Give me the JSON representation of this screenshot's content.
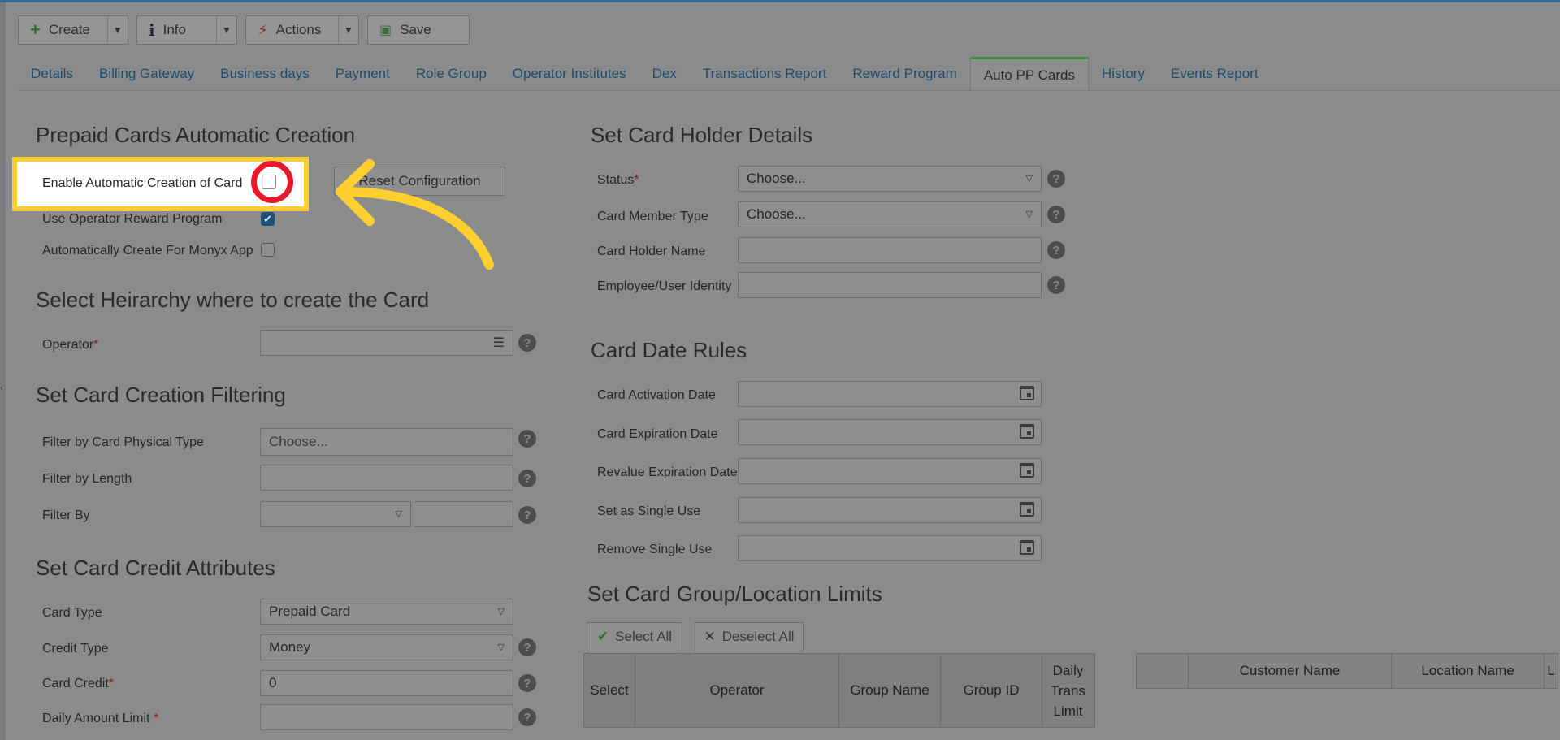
{
  "toolbar": {
    "create_label": "Create",
    "info_label": "Info",
    "actions_label": "Actions",
    "save_label": "Save"
  },
  "tabs": [
    {
      "label": "Details"
    },
    {
      "label": "Billing Gateway"
    },
    {
      "label": "Business days"
    },
    {
      "label": "Payment"
    },
    {
      "label": "Role Group"
    },
    {
      "label": "Operator Institutes"
    },
    {
      "label": "Dex"
    },
    {
      "label": "Transactions Report"
    },
    {
      "label": "Reward Program"
    },
    {
      "label": "Auto PP Cards",
      "active": true
    },
    {
      "label": "History"
    },
    {
      "label": "Events Report"
    }
  ],
  "auto_creation": {
    "title": "Prepaid Cards Automatic Creation",
    "enable_label": "Enable Automatic Creation of Card",
    "enable_checked": false,
    "reward_label": "Use Operator Reward Program",
    "reward_checked": true,
    "monyx_label": "Automatically Create For Monyx App",
    "monyx_checked": false,
    "reset_button": "Reset Configuration"
  },
  "hierarchy": {
    "title": "Select Heirarchy where to create the Card",
    "operator_label": "Operator",
    "operator_value": ""
  },
  "filtering": {
    "title": "Set Card Creation Filtering",
    "physical_type_label": "Filter by Card Physical Type",
    "physical_type_placeholder": "Choose...",
    "length_label": "Filter by Length",
    "filter_by_label": "Filter By"
  },
  "credit": {
    "title": "Set Card Credit Attributes",
    "card_type_label": "Card Type",
    "card_type_value": "Prepaid Card",
    "credit_type_label": "Credit Type",
    "credit_type_value": "Money",
    "card_credit_label": "Card Credit",
    "card_credit_value": "0",
    "daily_limit_label": "Daily Amount Limit",
    "daily_limit_value": ""
  },
  "holder": {
    "title": "Set Card Holder Details",
    "status_label": "Status",
    "status_value": "Choose...",
    "member_type_label": "Card Member Type",
    "member_type_value": "Choose...",
    "holder_name_label": "Card Holder Name",
    "identity_label": "Employee/User Identity"
  },
  "date_rules": {
    "title": "Card Date Rules",
    "activation_label": "Card Activation Date",
    "expiration_label": "Card Expiration Date",
    "revalue_label": "Revalue Expiration Date",
    "single_use_label": "Set as Single Use",
    "remove_single_use_label": "Remove Single Use"
  },
  "limits": {
    "title": "Set Card Group/Location Limits",
    "select_all": "Select All",
    "deselect_all": "Deselect All",
    "columns": [
      "Select",
      "Operator",
      "Group Name",
      "Group ID",
      "Daily Trans Limit"
    ],
    "columns_right": [
      "",
      "Customer Name",
      "Location Name",
      "L"
    ]
  },
  "colors": {
    "highlight": "#ffcf2f",
    "ring": "#e6192a",
    "arrow": "#ffcf2f"
  }
}
